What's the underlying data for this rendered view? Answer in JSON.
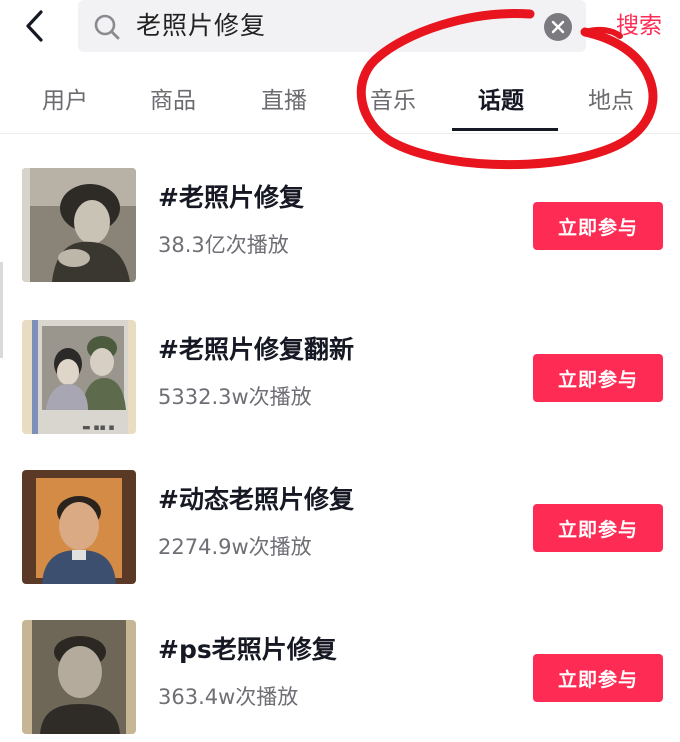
{
  "header": {
    "search_query": "老照片修复",
    "search_button": "搜索"
  },
  "tabs": [
    {
      "label": "用户"
    },
    {
      "label": "商品"
    },
    {
      "label": "直播"
    },
    {
      "label": "音乐"
    },
    {
      "label": "话题",
      "active": true
    },
    {
      "label": "地点"
    }
  ],
  "results": [
    {
      "title": "#老照片修复",
      "plays": "38.3亿次播放",
      "action": "立即参与"
    },
    {
      "title": "#老照片修复翻新",
      "plays": "5332.3w次播放",
      "action": "立即参与"
    },
    {
      "title": "#动态老照片修复",
      "plays": "2274.9w次播放",
      "action": "立即参与"
    },
    {
      "title": "#ps老照片修复",
      "plays": "363.4w次播放",
      "action": "立即参与"
    }
  ],
  "colors": {
    "accent": "#fe2c55",
    "annotation": "#e8141e",
    "search_bg": "#f2f2f4"
  },
  "icons": {
    "back": "chevron-left-icon",
    "search": "search-icon",
    "clear": "clear-icon"
  }
}
